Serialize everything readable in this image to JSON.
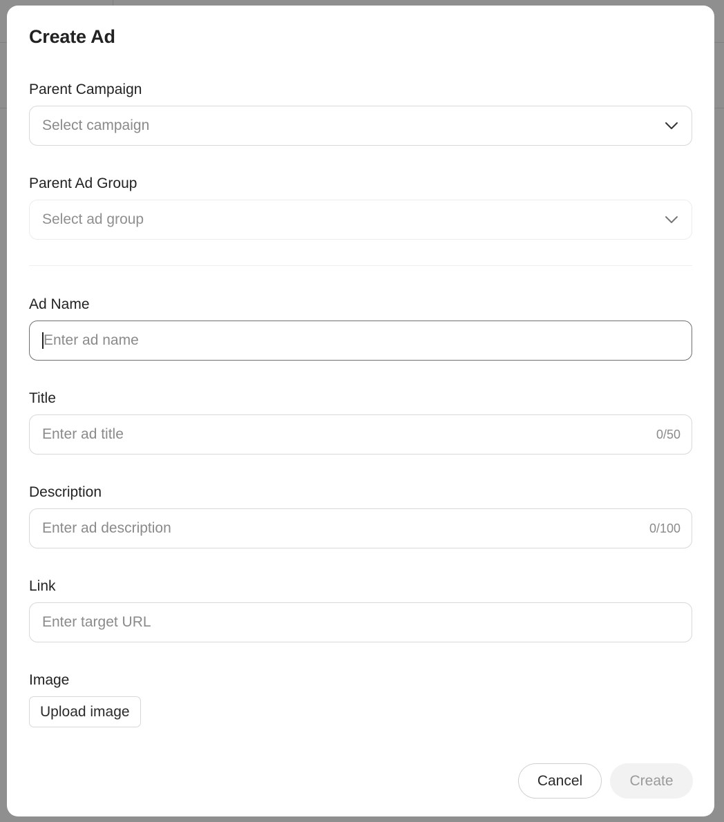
{
  "modal": {
    "title": "Create Ad"
  },
  "form": {
    "parent_campaign": {
      "label": "Parent Campaign",
      "placeholder": "Select campaign",
      "icon": "chevron-down-icon"
    },
    "parent_ad_group": {
      "label": "Parent Ad Group",
      "placeholder": "Select ad group",
      "icon": "chevron-down-icon"
    },
    "ad_name": {
      "label": "Ad Name",
      "placeholder": "Enter ad name",
      "value": ""
    },
    "title": {
      "label": "Title",
      "placeholder": "Enter ad title",
      "counter": "0/50"
    },
    "description": {
      "label": "Description",
      "placeholder": "Enter ad description",
      "counter": "0/100"
    },
    "link": {
      "label": "Link",
      "placeholder": "Enter target URL"
    },
    "image": {
      "label": "Image",
      "upload_label": "Upload image"
    }
  },
  "footer": {
    "cancel_label": "Cancel",
    "create_label": "Create"
  },
  "colors": {
    "overlay": "#8e8e8e",
    "modal_bg": "#ffffff",
    "text": "#222222",
    "placeholder": "#8a8a8a",
    "border": "#d8d8d8",
    "focus_border": "#6f6f6f",
    "create_disabled_bg": "#f2f2f2"
  }
}
